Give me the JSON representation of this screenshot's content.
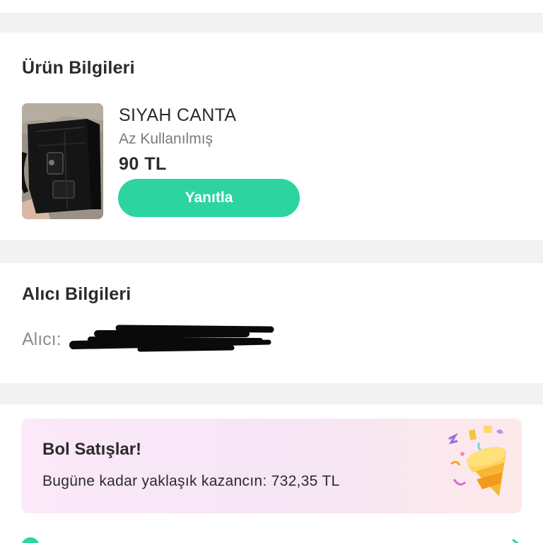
{
  "product_section": {
    "title": "Ürün Bilgileri",
    "product": {
      "name": "SIYAH CANTA",
      "condition": "Az Kullanılmış",
      "price": "90 TL",
      "image": "black-handbag-photo"
    },
    "reply_button": "Yanıtla"
  },
  "buyer_section": {
    "title": "Alıcı Bilgileri",
    "buyer_label": "Alıcı:"
  },
  "promo": {
    "title": "Bol Satışlar!",
    "text": "Bugüne kadar yaklaşık kazancın: 732,35 TL",
    "icon": "party-popper-icon"
  },
  "colors": {
    "accent": "#2dd4a0",
    "text": "#2b2b2b",
    "muted": "#7a7a7a",
    "background": "#f2f2f2"
  }
}
